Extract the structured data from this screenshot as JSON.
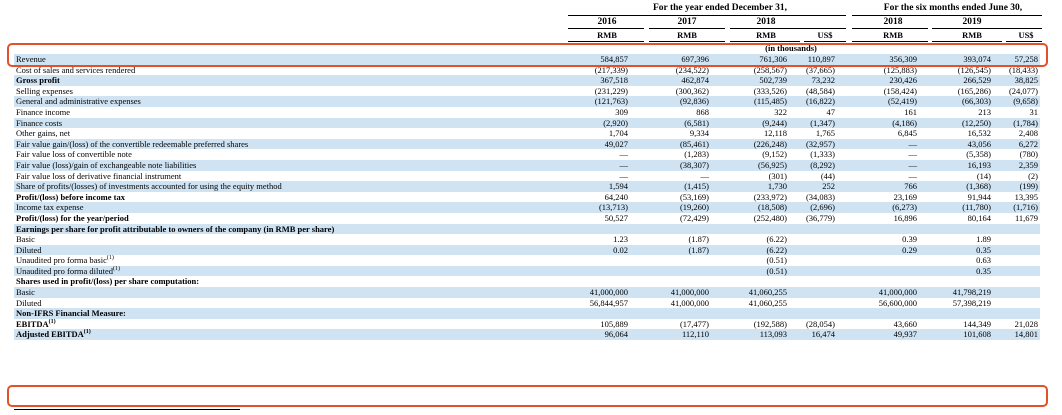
{
  "header": {
    "period_year": "For the year ended December 31,",
    "period_six": "For the six months ended June 30,",
    "years": [
      "2016",
      "2017",
      "2018",
      "",
      "2018",
      "2019",
      ""
    ],
    "currencies": [
      "RMB",
      "RMB",
      "RMB",
      "US$",
      "RMB",
      "RMB",
      "US$"
    ],
    "units": "(in thousands)"
  },
  "rows": [
    {
      "label": "Revenue",
      "values": [
        "584,857",
        "697,396",
        "761,306",
        "110,897",
        "356,309",
        "393,074",
        "57,258"
      ],
      "bold": false,
      "shade": true
    },
    {
      "label": "Cost of sales and services rendered",
      "values": [
        "(217,339)",
        "(234,522)",
        "(258,567)",
        "(37,665)",
        "(125,883)",
        "(126,545)",
        "(18,433)"
      ],
      "bold": false,
      "shade": false
    },
    {
      "label": "Gross profit",
      "values": [
        "367,518",
        "462,874",
        "502,739",
        "73,232",
        "230,426",
        "266,529",
        "38,825"
      ],
      "bold": true,
      "shade": true
    },
    {
      "label": "Selling expenses",
      "values": [
        "(231,229)",
        "(300,362)",
        "(333,526)",
        "(48,584)",
        "(158,424)",
        "(165,286)",
        "(24,077)"
      ],
      "bold": false,
      "shade": false
    },
    {
      "label": "General and administrative expenses",
      "values": [
        "(121,763)",
        "(92,836)",
        "(115,485)",
        "(16,822)",
        "(52,419)",
        "(66,303)",
        "(9,658)"
      ],
      "bold": false,
      "shade": true
    },
    {
      "label": "Finance income",
      "values": [
        "309",
        "868",
        "322",
        "47",
        "161",
        "213",
        "31"
      ],
      "bold": false,
      "shade": false
    },
    {
      "label": "Finance costs",
      "values": [
        "(2,920)",
        "(6,581)",
        "(9,244)",
        "(1,347)",
        "(4,186)",
        "(12,250)",
        "(1,784)"
      ],
      "bold": false,
      "shade": true
    },
    {
      "label": "Other gains, net",
      "values": [
        "1,704",
        "9,334",
        "12,118",
        "1,765",
        "6,845",
        "16,532",
        "2,408"
      ],
      "bold": false,
      "shade": false
    },
    {
      "label": "Fair value gain/(loss) of the convertible redeemable preferred shares",
      "values": [
        "49,027",
        "(85,461)",
        "(226,248)",
        "(32,957)",
        "—",
        "43,056",
        "6,272"
      ],
      "bold": false,
      "shade": true
    },
    {
      "label": "Fair value loss of convertible note",
      "values": [
        "—",
        "(1,283)",
        "(9,152)",
        "(1,333)",
        "—",
        "(5,358)",
        "(780)"
      ],
      "bold": false,
      "shade": false
    },
    {
      "label": "Fair value (loss)/gain of exchangeable note liabilities",
      "values": [
        "—",
        "(38,307)",
        "(56,925)",
        "(8,292)",
        "—",
        "16,193",
        "2,359"
      ],
      "bold": false,
      "shade": true
    },
    {
      "label": "Fair value loss of derivative financial instrument",
      "values": [
        "—",
        "—",
        "(301)",
        "(44)",
        "—",
        "(14)",
        "(2)"
      ],
      "bold": false,
      "shade": false
    },
    {
      "label": "Share of profits/(losses) of investments accounted for using the equity method",
      "values": [
        "1,594",
        "(1,415)",
        "1,730",
        "252",
        "766",
        "(1,368)",
        "(199)"
      ],
      "bold": false,
      "shade": true
    },
    {
      "label": "Profit/(loss) before income tax",
      "values": [
        "64,240",
        "(53,169)",
        "(233,972)",
        "(34,083)",
        "23,169",
        "91,944",
        "13,395"
      ],
      "bold": true,
      "shade": false
    },
    {
      "label": "Income tax expense",
      "values": [
        "(13,713)",
        "(19,260)",
        "(18,508)",
        "(2,696)",
        "(6,273)",
        "(11,780)",
        "(1,716)"
      ],
      "bold": false,
      "shade": true
    },
    {
      "label": "Profit/(loss) for the year/period",
      "values": [
        "50,527",
        "(72,429)",
        "(252,480)",
        "(36,779)",
        "16,896",
        "80,164",
        "11,679"
      ],
      "bold": true,
      "shade": false
    },
    {
      "label": "Earnings per share for profit attributable to owners of the company (in RMB per share)",
      "values": [
        "",
        "",
        "",
        "",
        "",
        "",
        ""
      ],
      "bold": true,
      "shade": true
    },
    {
      "label": "Basic",
      "values": [
        "1.23",
        "(1.87)",
        "(6.22)",
        "",
        "0.39",
        "1.89",
        ""
      ],
      "bold": false,
      "shade": false
    },
    {
      "label": "Diluted",
      "values": [
        "0.02",
        "(1.87)",
        "(6.22)",
        "",
        "0.29",
        "0.35",
        ""
      ],
      "bold": false,
      "shade": true
    },
    {
      "label": "Unaudited pro forma basic",
      "sup": "(1)",
      "values": [
        "",
        "",
        "(0.51)",
        "",
        "",
        "0.63",
        ""
      ],
      "bold": false,
      "shade": false
    },
    {
      "label": "Unaudited pro forma diluted",
      "sup": "(1)",
      "values": [
        "",
        "",
        "(0.51)",
        "",
        "",
        "0.35",
        ""
      ],
      "bold": false,
      "shade": true
    },
    {
      "label": "Shares used in profit/(loss) per share computation:",
      "values": [
        "",
        "",
        "",
        "",
        "",
        "",
        ""
      ],
      "bold": true,
      "shade": false
    },
    {
      "label": "Basic",
      "values": [
        "41,000,000",
        "41,000,000",
        "41,060,255",
        "",
        "41,000,000",
        "41,798,219",
        ""
      ],
      "bold": false,
      "shade": true
    },
    {
      "label": "Diluted",
      "values": [
        "56,844,957",
        "41,000,000",
        "41,060,255",
        "",
        "56,600,000",
        "57,398,219",
        ""
      ],
      "bold": false,
      "shade": false
    },
    {
      "label": "Non-IFRS Financial Measure:",
      "values": [
        "",
        "",
        "",
        "",
        "",
        "",
        ""
      ],
      "bold": true,
      "shade": true
    },
    {
      "label": "EBITDA",
      "sup": "(1)",
      "values": [
        "105,889",
        "(17,477)",
        "(192,588)",
        "(28,054)",
        "43,660",
        "144,349",
        "21,028"
      ],
      "bold": true,
      "shade": false
    },
    {
      "label": "Adjusted EBITDA",
      "sup": "(1)",
      "values": [
        "96,064",
        "112,110",
        "113,093",
        "16,474",
        "49,937",
        "101,608",
        "14,801"
      ],
      "bold": true,
      "shade": true
    }
  ],
  "colors": {
    "shade": "#cfe3f3",
    "highlight": "#e2512a"
  }
}
